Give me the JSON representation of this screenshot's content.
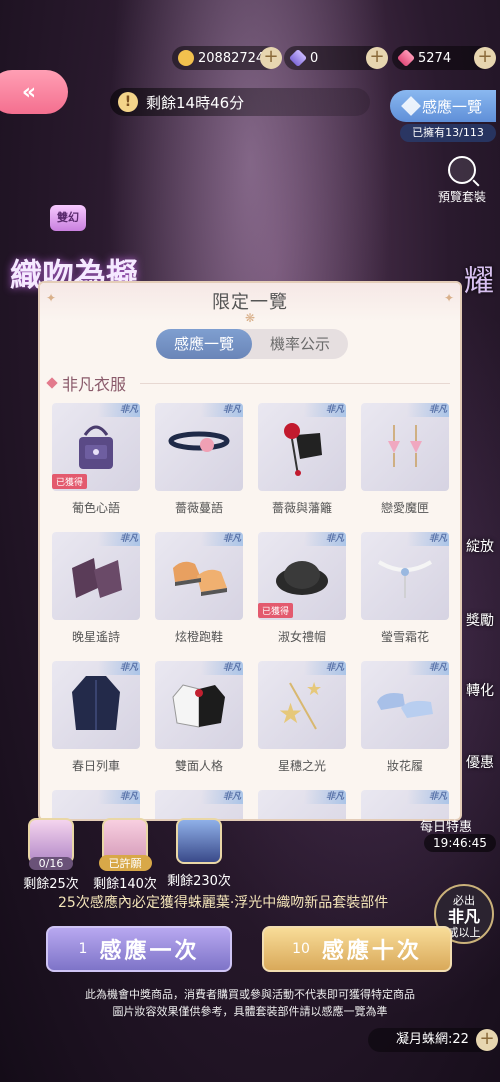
{
  "currency": {
    "gold": "20882724",
    "diamond": "0",
    "gems": "5274"
  },
  "header": {
    "time_left": "剩餘14時46分",
    "collection_button": "感應一覽",
    "owned": "已擁有13/113",
    "preview": "預覽套裝"
  },
  "banner": {
    "tag": "雙幻",
    "title": "織吻為擬",
    "title_right": "耀"
  },
  "side_labels": [
    "綻放",
    "獎勵",
    "轉化",
    "優惠"
  ],
  "modal": {
    "title": "限定一覽",
    "tabs": [
      "感應一覽",
      "機率公示"
    ],
    "section": "非凡衣服",
    "ribbon": "非凡",
    "obtained_label": "已獲得",
    "items": [
      {
        "name": "葡色心語",
        "obtained": true
      },
      {
        "name": "薔薇蔓語",
        "obtained": false
      },
      {
        "name": "薔薇與藩籬",
        "obtained": false
      },
      {
        "name": "戀愛魔匣",
        "obtained": false
      },
      {
        "name": "晚星遙詩",
        "obtained": false
      },
      {
        "name": "炫橙跑鞋",
        "obtained": false
      },
      {
        "name": "淑女禮帽",
        "obtained": true
      },
      {
        "name": "瑩雪霜花",
        "obtained": false
      },
      {
        "name": "春日列車",
        "obtained": false
      },
      {
        "name": "雙面人格",
        "obtained": false
      },
      {
        "name": "星穗之光",
        "obtained": false
      },
      {
        "name": "妝花履",
        "obtained": false
      }
    ]
  },
  "rewards": [
    {
      "pill": "0/16",
      "text": "剩餘25次"
    },
    {
      "pill": "已許願",
      "text": "剩餘140次"
    },
    {
      "pill": "",
      "text": "剩餘230次"
    }
  ],
  "daily": {
    "label": "每日特惠",
    "time": "19:46:45"
  },
  "guarantee": "25次感應內必定獲得蛛麗葉·浮光中織吻新品套裝部件",
  "must_badge": {
    "top": "必出",
    "middle": "非凡",
    "bottom": "或以上"
  },
  "buttons": {
    "once_num": "1",
    "once_label": "感應一次",
    "ten_num": "10",
    "ten_label": "感應十次"
  },
  "disclaimer": [
    "此為機會中獎商品，消費者購買或參與活動不代表即可獲得特定商品",
    "圖片妝容效果僅供參考，具體套裝部件請以感應一覽為準"
  ],
  "ticket": "凝月蛛網:22"
}
